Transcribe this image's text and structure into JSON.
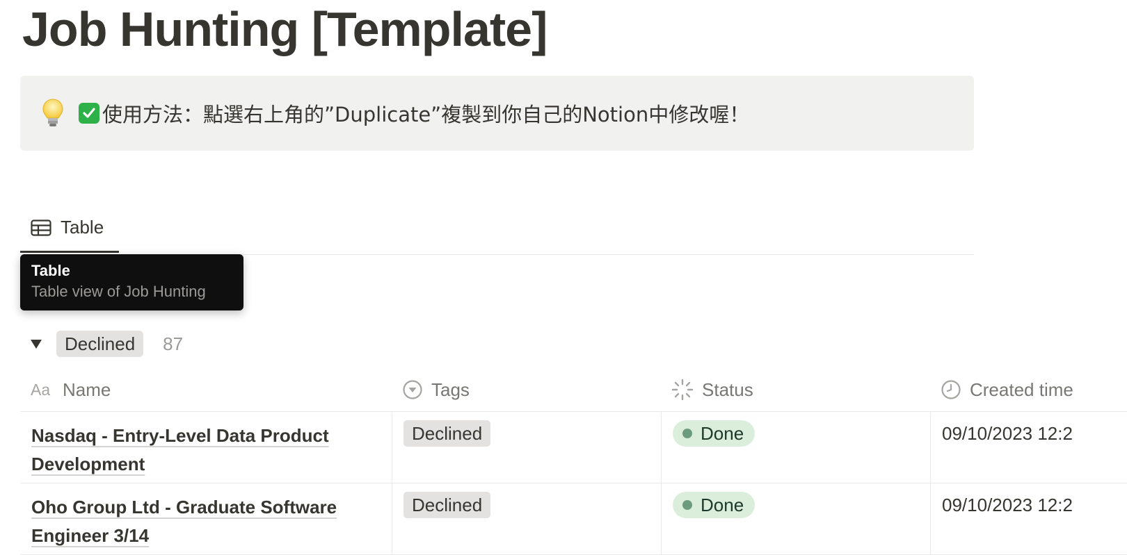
{
  "page": {
    "title": "Job Hunting [Template]"
  },
  "callout": {
    "icon": "lightbulb-icon",
    "check_icon": "check-mark-button-icon",
    "text": "使用方法：點選右上角的”Duplicate”複製到你自己的Notion中修改喔！"
  },
  "views": {
    "tabs": [
      {
        "label": "Table",
        "icon": "table-icon"
      }
    ]
  },
  "tooltip": {
    "title": "Table",
    "subtitle": "Table view of Job Hunting"
  },
  "group": {
    "label": "Declined",
    "count": "87"
  },
  "table": {
    "columns": [
      {
        "label": "Name",
        "icon": "title-aa-icon"
      },
      {
        "label": "Tags",
        "icon": "select-icon"
      },
      {
        "label": "Status",
        "icon": "status-icon"
      },
      {
        "label": "Created time",
        "icon": "clock-icon"
      }
    ],
    "rows": [
      {
        "name_line1": "Nasdaq - Entry-Level Data Product",
        "name_line2": "Development",
        "tag": "Declined",
        "status": "Done",
        "created": "09/10/2023 12:2"
      },
      {
        "name_line1": "Oho Group Ltd - Graduate Software",
        "name_line2": "Engineer 3/14",
        "tag": "Declined",
        "status": "Done",
        "created": "09/10/2023 12:2"
      }
    ]
  },
  "colors": {
    "text": "#37352f",
    "callout_bg": "#f1f1ef",
    "tag_bg": "#e3e2e0",
    "status_bg": "#dbeddb",
    "status_dot": "#6c9b7d",
    "tooltip_bg": "#0f0f0f"
  }
}
